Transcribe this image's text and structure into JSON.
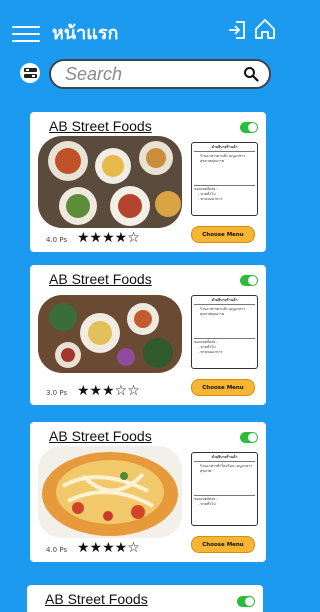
{
  "header": {
    "title": "หน้าแรก",
    "menu_icon": "hamburger-icon",
    "login_icon": "login-icon",
    "home_icon": "home-icon"
  },
  "search": {
    "placeholder": "Search",
    "value": "",
    "filter_icon": "filter-icon",
    "search_icon": "search-icon"
  },
  "cards": [
    {
      "name": "AB Street Foods",
      "enabled": true,
      "rating_text": "4.0 Ps",
      "stars": "★★★★☆",
      "description_title": "คำอธิบายร้านค้า",
      "description_body": "ร้านอาหารตามสั่ง เมนูอาหารสุขภาพคุณภาพ",
      "delivery_label": "ขอบเขตจัดส่ง :",
      "delivery_items": [
        "- ขายทั่วไป",
        "- ทานขออาหาร"
      ],
      "button_label": "Choose Menu"
    },
    {
      "name": "AB Street Foods",
      "enabled": true,
      "rating_text": "3.0 Ps",
      "stars": "★★★☆☆",
      "description_title": "คำอธิบายร้านค้า",
      "description_body": "ร้านอาหารตามสั่ง เมนูอาหารสุขภาพคุณภาพ",
      "delivery_label": "ขอบเขตจัดส่ง :",
      "delivery_items": [
        "- ขายทั่วไป",
        "- ทานขออาหาร"
      ],
      "button_label": "Choose Menu"
    },
    {
      "name": "AB Street Foods",
      "enabled": true,
      "rating_text": "4.0 Ps",
      "stars": "★★★★☆",
      "description_title": "คำอธิบายร้านค้า",
      "description_body": "ร้านอาหารทำใหม่ร้อน เมนูอาหารสุขภาพ",
      "delivery_label": "ขอบเขตจัดส่ง :",
      "delivery_items": [
        "- ขายทั่วไป"
      ],
      "button_label": "Choose Menu"
    }
  ],
  "peek_card": {
    "name": "AB Street Foods",
    "enabled": true
  },
  "colors": {
    "background": "#1b9af0",
    "toggle_on": "#2bbc3a",
    "button": "#f6b534"
  }
}
